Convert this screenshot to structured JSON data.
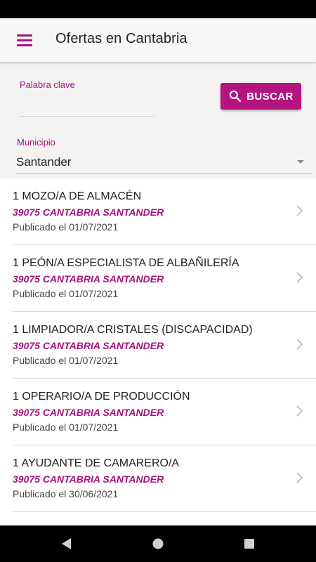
{
  "app_bar": {
    "title": "Ofertas en Cantabria",
    "menu_icon": "hamburger-menu-icon",
    "accent_color": "#a6117e"
  },
  "search": {
    "keyword_label": "Palabra clave",
    "keyword_value": "",
    "button_label": "BUSCAR",
    "button_icon": "search-icon",
    "button_color": "#b3147f",
    "municipality_label": "Municipio",
    "municipality_value": "Santander"
  },
  "offers": [
    {
      "title": "1 MOZO/A DE ALMACÉN",
      "location": "39075 CANTABRIA SANTANDER",
      "date": "Publicado el 01/07/2021"
    },
    {
      "title": "1 PEÓN/A ESPECIALISTA DE ALBAÑILERÍA",
      "location": "39075 CANTABRIA SANTANDER",
      "date": "Publicado el 01/07/2021"
    },
    {
      "title": "1 LIMPIADOR/A CRISTALES (DISCAPACIDAD)",
      "location": "39075 CANTABRIA SANTANDER",
      "date": "Publicado el 01/07/2021"
    },
    {
      "title": "1 OPERARIO/A DE PRODUCCIÓN",
      "location": "39075 CANTABRIA SANTANDER",
      "date": "Publicado el 01/07/2021"
    },
    {
      "title": "1 AYUDANTE DE CAMARERO/A",
      "location": "39075 CANTABRIA SANTANDER",
      "date": "Publicado el 30/06/2021"
    }
  ],
  "nav": {
    "back_icon": "back-triangle-icon",
    "home_icon": "home-circle-icon",
    "recents_icon": "recents-square-icon"
  }
}
